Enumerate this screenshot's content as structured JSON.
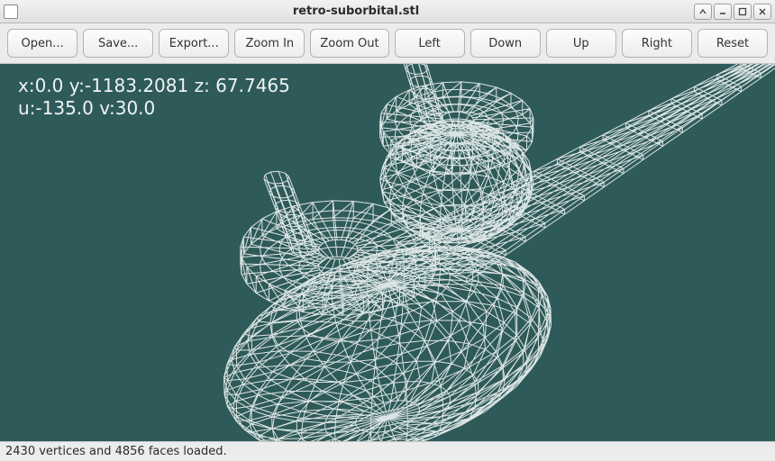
{
  "window": {
    "title": "retro-suborbital.stl"
  },
  "toolbar": {
    "open": "Open...",
    "save": "Save...",
    "export": "Export...",
    "zoom_in": "Zoom In",
    "zoom_out": "Zoom Out",
    "left": "Left",
    "down": "Down",
    "up": "Up",
    "right": "Right",
    "reset": "Reset"
  },
  "camera": {
    "x": "0.0",
    "y": "-1183.2081",
    "z": "67.7465",
    "u": "-135.0",
    "v": "30.0"
  },
  "overlay_line1": "x:0.0 y:-1183.2081 z: 67.7465",
  "overlay_line2": "u:-135.0 v:30.0",
  "status": {
    "vertices": 2430,
    "faces": 4856,
    "text": "2430 vertices and 4856 faces loaded."
  },
  "wireframe_color": "#eef3f3",
  "viewport_bg": "#2f5a5a"
}
